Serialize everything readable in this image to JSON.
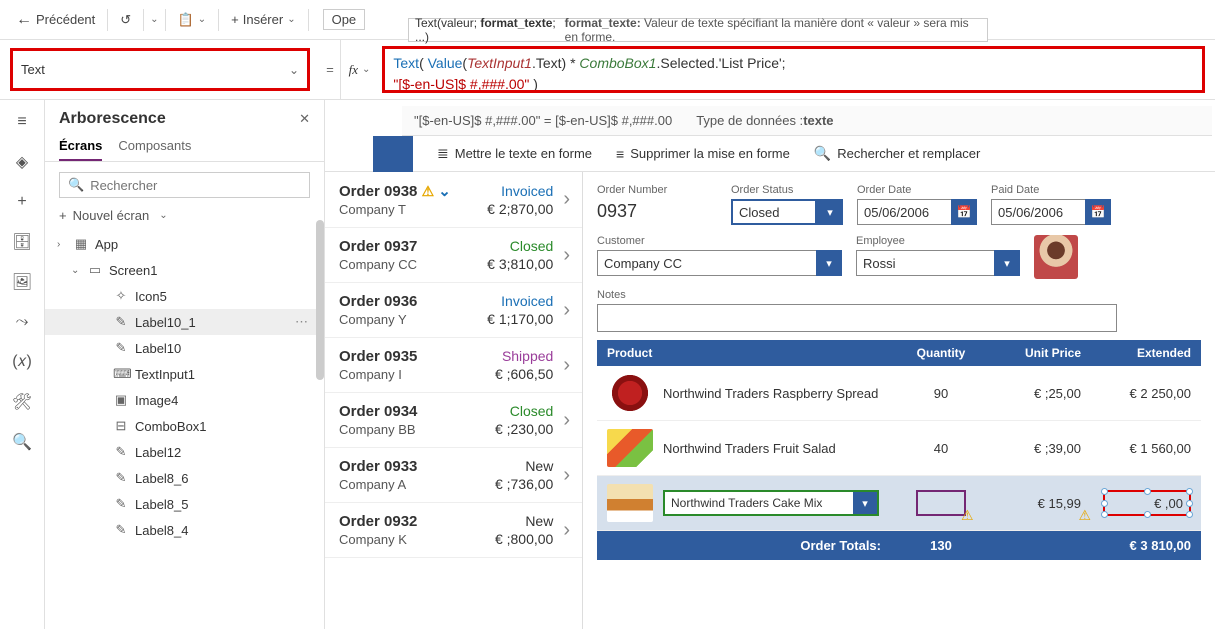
{
  "toolbar": {
    "back": "Précédent",
    "insert": "Insérer",
    "open": "Ope"
  },
  "tooltip": {
    "sig_pre": "Text(valeur; ",
    "sig_bold": "format_texte",
    "sig_post": "; ...)",
    "param": "format_texte:",
    "desc": "Valeur de texte spécifiant la manière dont « valeur » sera mis en forme."
  },
  "property": {
    "name": "Text"
  },
  "formula": {
    "fn_text": "Text",
    "lp": "( ",
    "fn_value": "Value",
    "lp2": "(",
    "ref1": "TextInput1",
    "dot_text": ".Text) * ",
    "ref2": "ComboBox1",
    "tail": ".Selected.'List Price';",
    "fmt": "\"[$-en-US]$ #,###.00\"",
    "rp": " )"
  },
  "result": {
    "lhs": "\"[$-en-US]$ #,###.00\"  =  [$-en-US]$ #,###.00",
    "dt_label": "Type de données :",
    "dt_value": "texte"
  },
  "tree": {
    "title": "Arborescence",
    "tabs": {
      "screens": "Écrans",
      "components": "Composants"
    },
    "search_placeholder": "Rechercher",
    "new_screen": "Nouvel écran",
    "items": [
      {
        "label": "App",
        "level": 0,
        "icon": "▦",
        "expand": "›"
      },
      {
        "label": "Screen1",
        "level": 1,
        "icon": "▭",
        "expand": "⌄"
      },
      {
        "label": "Icon5",
        "level": 2,
        "icon": "✧"
      },
      {
        "label": "Label10_1",
        "level": 2,
        "icon": "✎",
        "selected": true
      },
      {
        "label": "Label10",
        "level": 2,
        "icon": "✎"
      },
      {
        "label": "TextInput1",
        "level": 2,
        "icon": "⌨"
      },
      {
        "label": "Image4",
        "level": 2,
        "icon": "▣"
      },
      {
        "label": "ComboBox1",
        "level": 2,
        "icon": "⊟"
      },
      {
        "label": "Label12",
        "level": 2,
        "icon": "✎"
      },
      {
        "label": "Label8_6",
        "level": 2,
        "icon": "✎"
      },
      {
        "label": "Label8_5",
        "level": 2,
        "icon": "✎"
      },
      {
        "label": "Label8_4",
        "level": 2,
        "icon": "✎"
      }
    ]
  },
  "cmdbar": {
    "format": "Mettre le texte en forme",
    "remove": "Supprimer la mise en forme",
    "find": "Rechercher et remplacer"
  },
  "orders": [
    {
      "title": "Order 0938",
      "company": "Company T",
      "status": "Invoiced",
      "status_class": "st-invoiced",
      "amount": "€ 2;870,00",
      "warn": true
    },
    {
      "title": "Order 0937",
      "company": "Company CC",
      "status": "Closed",
      "status_class": "st-closed",
      "amount": "€ 3;810,00"
    },
    {
      "title": "Order 0936",
      "company": "Company Y",
      "status": "Invoiced",
      "status_class": "st-invoiced",
      "amount": "€ 1;170,00"
    },
    {
      "title": "Order 0935",
      "company": "Company I",
      "status": "Shipped",
      "status_class": "st-shipped",
      "amount": "€ ;606,50"
    },
    {
      "title": "Order 0934",
      "company": "Company BB",
      "status": "Closed",
      "status_class": "st-closed",
      "amount": "€ ;230,00"
    },
    {
      "title": "Order 0933",
      "company": "Company A",
      "status": "New",
      "status_class": "st-new",
      "amount": "€ ;736,00"
    },
    {
      "title": "Order 0932",
      "company": "Company K",
      "status": "New",
      "status_class": "st-new",
      "amount": "€ ;800,00"
    }
  ],
  "details": {
    "labels": {
      "order_number": "Order Number",
      "order_status": "Order Status",
      "order_date": "Order Date",
      "paid_date": "Paid Date",
      "customer": "Customer",
      "employee": "Employee",
      "notes": "Notes"
    },
    "order_number": "0937",
    "order_status": "Closed",
    "order_date": "05/06/2006",
    "paid_date": "05/06/2006",
    "customer": "Company CC",
    "employee": "Rossi"
  },
  "products": {
    "headers": {
      "product": "Product",
      "qty": "Quantity",
      "price": "Unit Price",
      "ext": "Extended"
    },
    "rows": [
      {
        "name": "Northwind Traders Raspberry Spread",
        "qty": "90",
        "price": "€ ;25,00",
        "ext": "€ 2 250,00",
        "thumb": "t1"
      },
      {
        "name": "Northwind Traders Fruit Salad",
        "qty": "40",
        "price": "€ ;39,00",
        "ext": "€ 1 560,00",
        "thumb": "t2"
      }
    ],
    "edit_row": {
      "name": "Northwind Traders Cake Mix",
      "price": "€ 15,99",
      "ext": "€ ,00"
    },
    "totals": {
      "label": "Order Totals:",
      "qty": "130",
      "ext": "€ 3 810,00"
    }
  }
}
